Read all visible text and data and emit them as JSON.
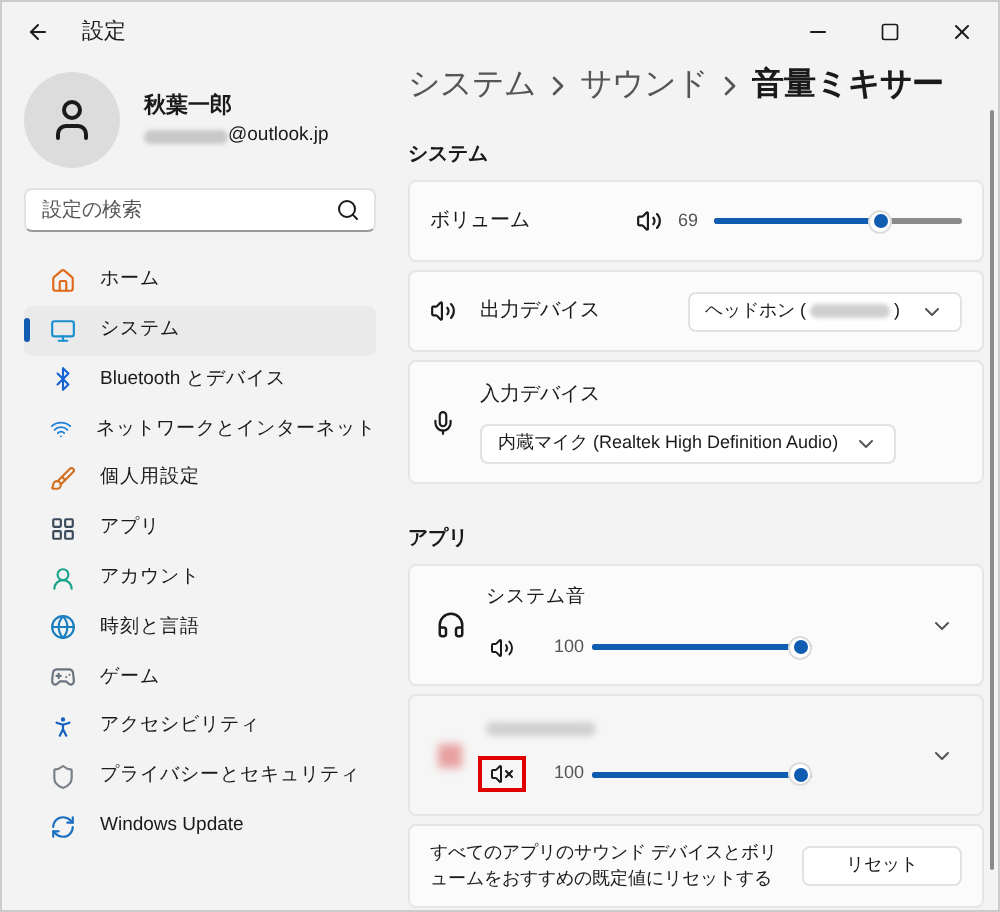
{
  "window": {
    "title": "設定"
  },
  "user": {
    "name": "秋葉一郎",
    "email": "@outlook.jp"
  },
  "search": {
    "placeholder": "設定の検索"
  },
  "sidebar": {
    "items": [
      {
        "label": "ホーム",
        "selected": false
      },
      {
        "label": "システム",
        "selected": true
      },
      {
        "label": "Bluetooth とデバイス",
        "selected": false
      },
      {
        "label": "ネットワークとインターネット",
        "selected": false
      },
      {
        "label": "個人用設定",
        "selected": false
      },
      {
        "label": "アプリ",
        "selected": false
      },
      {
        "label": "アカウント",
        "selected": false
      },
      {
        "label": "時刻と言語",
        "selected": false
      },
      {
        "label": "ゲーム",
        "selected": false
      },
      {
        "label": "アクセシビリティ",
        "selected": false
      },
      {
        "label": "プライバシーとセキュリティ",
        "selected": false
      },
      {
        "label": "Windows Update",
        "selected": false
      }
    ]
  },
  "breadcrumb": [
    "システム",
    "サウンド",
    "音量ミキサー"
  ],
  "system_section": {
    "heading": "システム",
    "volume": {
      "label": "ボリューム",
      "reading": "69",
      "level": 0.69
    },
    "output": {
      "label": "出力デバイス",
      "value_start": "ヘッドホン (",
      "value_end": ")"
    },
    "input": {
      "label": "入力デバイス",
      "value": "内蔵マイク (Realtek High Definition Audio)"
    }
  },
  "apps_section": {
    "heading": "アプリ",
    "apps": [
      {
        "name": "システム音",
        "kind": "system",
        "muted": false,
        "highlighted": false,
        "reading": "100",
        "level": 1.0
      },
      {
        "kind": "redacted",
        "muted": true,
        "highlighted": true,
        "reading": "100",
        "level": 1.0
      }
    ]
  },
  "reset": {
    "text": "すべてのアプリのサウンド デバイスとボリュームをおすすめの既定値にリセットする",
    "button": "リセット"
  }
}
